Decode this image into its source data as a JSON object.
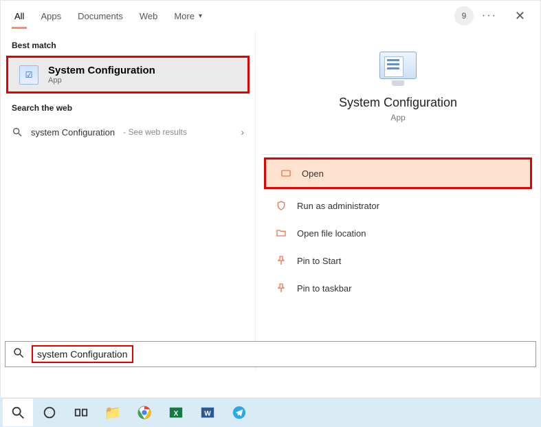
{
  "header": {
    "tabs": [
      "All",
      "Apps",
      "Documents",
      "Web",
      "More"
    ],
    "active_tab": "All",
    "avatar_badge": "9"
  },
  "left": {
    "best_match_header": "Best match",
    "best_match": {
      "title": "System Configuration",
      "subtitle": "App"
    },
    "search_web_header": "Search the web",
    "web_result": {
      "query": "system Configuration",
      "suffix": "- See web results"
    }
  },
  "preview": {
    "title": "System Configuration",
    "subtitle": "App"
  },
  "actions": {
    "open": "Open",
    "run_admin": "Run as administrator",
    "open_location": "Open file location",
    "pin_start": "Pin to Start",
    "pin_taskbar": "Pin to taskbar"
  },
  "search_input": {
    "value": "system Configuration"
  },
  "highlight_color": "#e40000"
}
